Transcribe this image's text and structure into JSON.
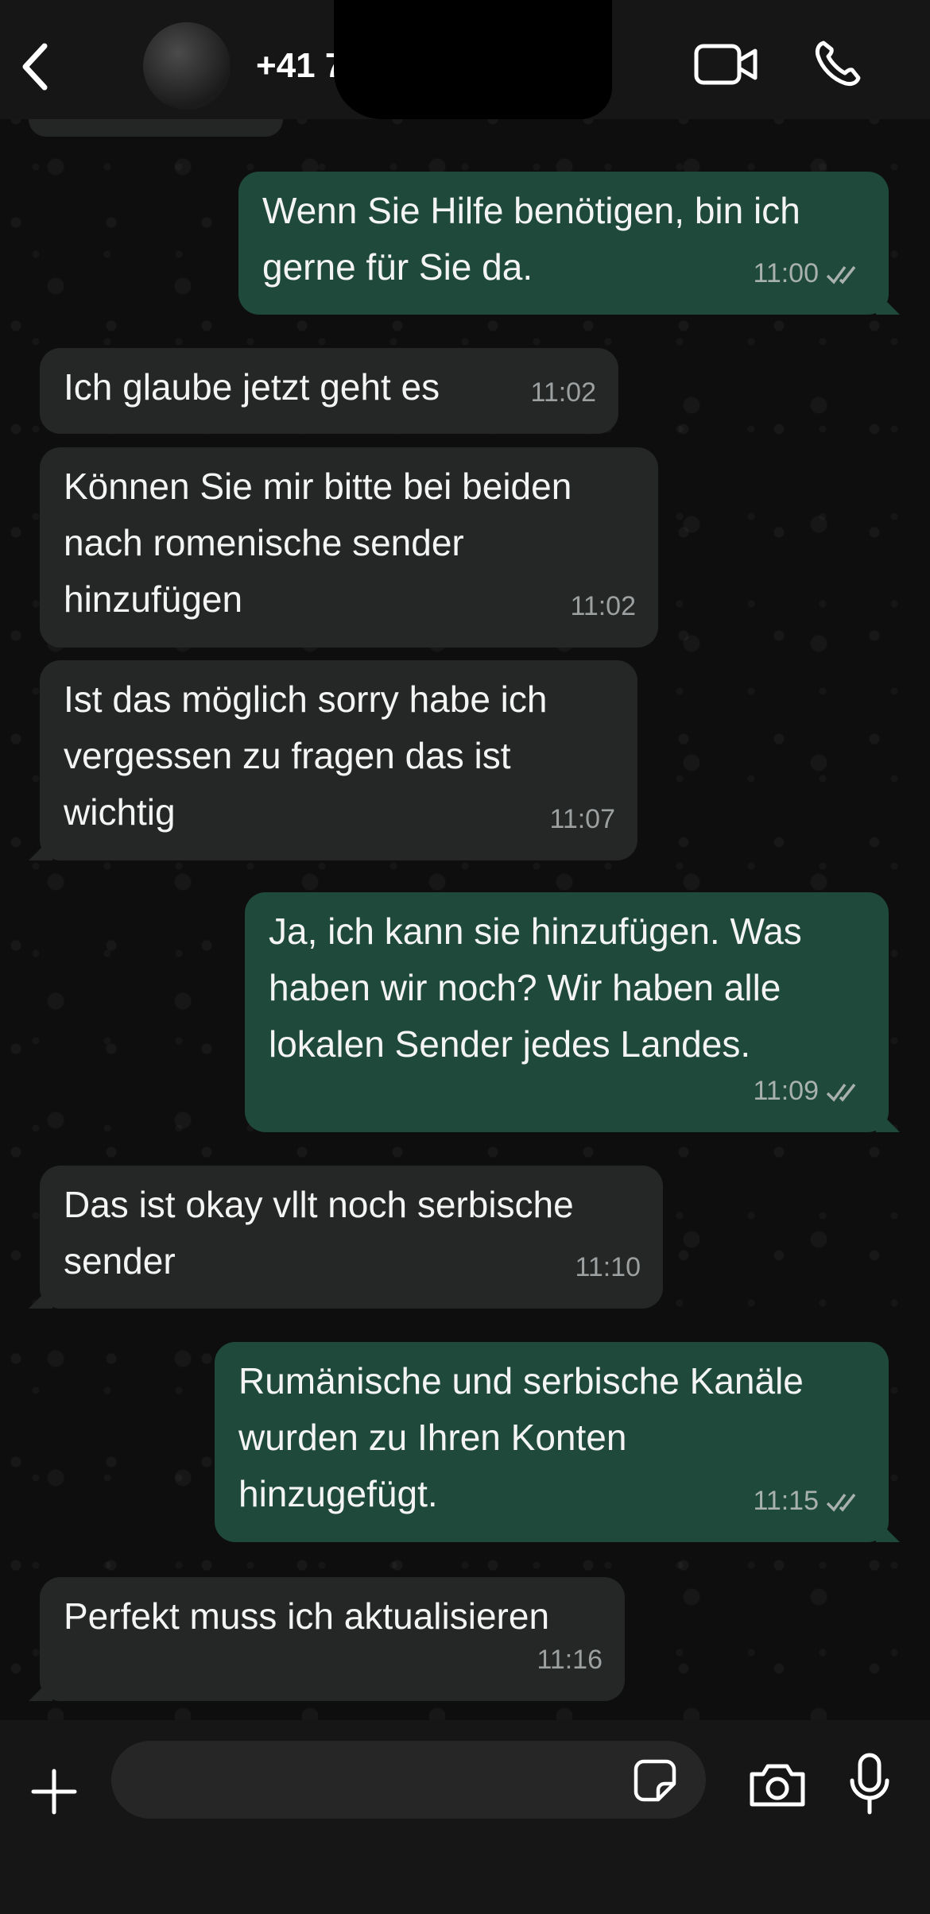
{
  "header": {
    "contact_name": "+41 7",
    "icons": {
      "back": "chevron-left-icon",
      "video": "video-camera-icon",
      "call": "phone-icon"
    }
  },
  "messages": [
    {
      "direction": "out",
      "text": "Wenn Sie Hilfe benötigen, bin ich\ngerne für Sie da.",
      "time": "11:00",
      "status": "read"
    },
    {
      "direction": "in",
      "text": "Ich glaube jetzt geht es",
      "time": "11:02"
    },
    {
      "direction": "in",
      "text": "Können Sie mir bitte bei beiden\nnach romenische sender\nhinzufügen",
      "time": "11:02"
    },
    {
      "direction": "in",
      "text": "Ist das möglich sorry habe ich\nvergessen zu fragen das ist\nwichtig",
      "time": "11:07"
    },
    {
      "direction": "out",
      "text": "Ja, ich kann sie hinzufügen. Was\nhaben wir noch? Wir haben alle\nlokalen Sender jedes Landes.",
      "time": "11:09",
      "status": "read"
    },
    {
      "direction": "in",
      "text": "Das ist okay vllt noch serbische\nsender",
      "time": "11:10"
    },
    {
      "direction": "out",
      "text": "Rumänische und serbische Kanäle\nwurden zu Ihren Konten\nhinzugefügt.",
      "time": "11:15",
      "status": "read"
    },
    {
      "direction": "in",
      "text": "Perfekt muss ich aktualisieren",
      "time": "11:16"
    }
  ],
  "composer": {
    "placeholder": "",
    "icons": {
      "attach": "plus-icon",
      "sticker": "sticker-icon",
      "camera": "camera-icon",
      "voice": "microphone-icon"
    }
  },
  "colors": {
    "header_bg": "#161616",
    "incoming_bubble": "#252727",
    "outgoing_bubble": "#1f4a3b",
    "timestamp": "#9da0a0"
  }
}
